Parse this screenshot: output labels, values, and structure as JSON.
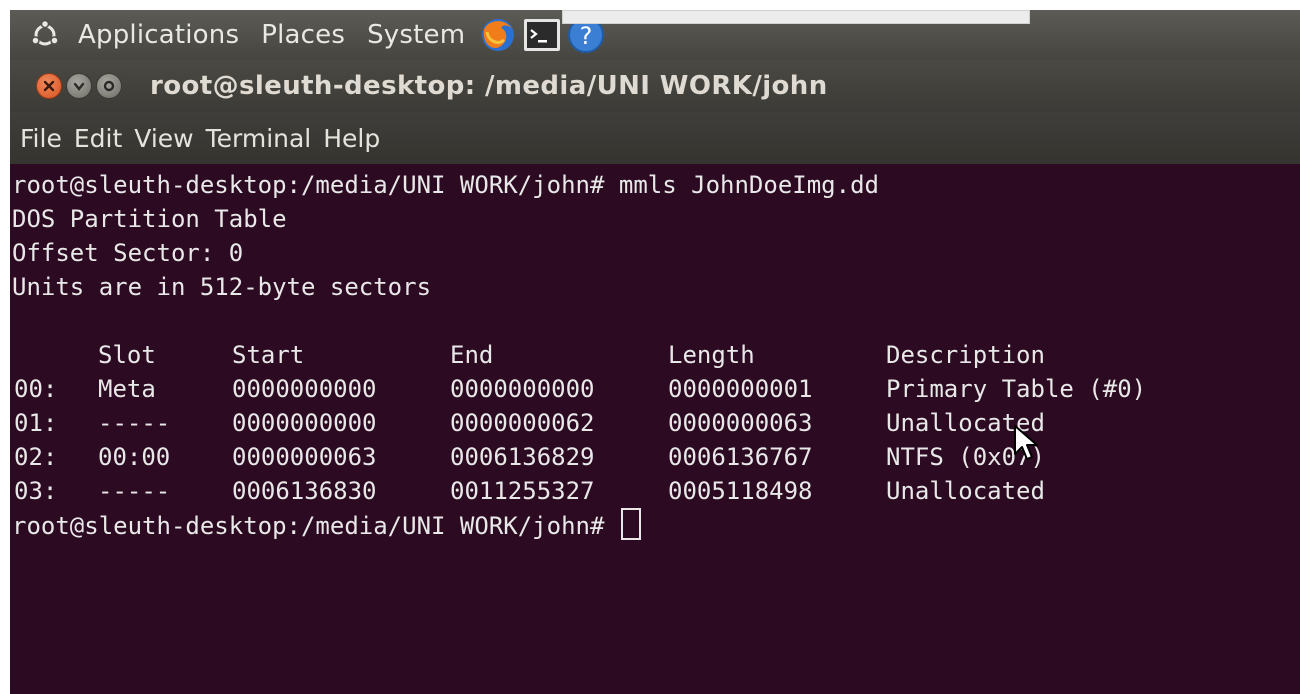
{
  "panel": {
    "menus": [
      "Applications",
      "Places",
      "System"
    ],
    "launchers": [
      "firefox-icon",
      "terminal-icon",
      "help-icon"
    ]
  },
  "window": {
    "title": "root@sleuth-desktop: /media/UNI WORK/john",
    "buttons": [
      "close",
      "minimize",
      "maximize"
    ]
  },
  "menubar": {
    "items": [
      "File",
      "Edit",
      "View",
      "Terminal",
      "Help"
    ]
  },
  "terminal": {
    "prompt": "root@sleuth-desktop:/media/UNI WORK/john#",
    "command": "mmls JohnDoeImg.dd",
    "output_header": [
      "DOS Partition Table",
      "Offset Sector: 0",
      "Units are in 512-byte sectors"
    ],
    "table": {
      "columns": [
        "",
        "Slot",
        "Start",
        "End",
        "Length",
        "Description"
      ],
      "rows": [
        [
          "00:",
          "Meta",
          "0000000000",
          "0000000000",
          "0000000001",
          "Primary Table (#0)"
        ],
        [
          "01:",
          "-----",
          "0000000000",
          "0000000062",
          "0000000063",
          "Unallocated"
        ],
        [
          "02:",
          "00:00",
          "0000000063",
          "0006136829",
          "0006136767",
          "NTFS (0x07)"
        ],
        [
          "03:",
          "-----",
          "0006136830",
          "0011255327",
          "0005118498",
          "Unallocated"
        ]
      ]
    }
  },
  "colors": {
    "terminal_bg": "#2c0a21",
    "terminal_fg": "#e8e8e8",
    "panel_bg": "#4f4e48",
    "close_button": "#e0602a"
  }
}
